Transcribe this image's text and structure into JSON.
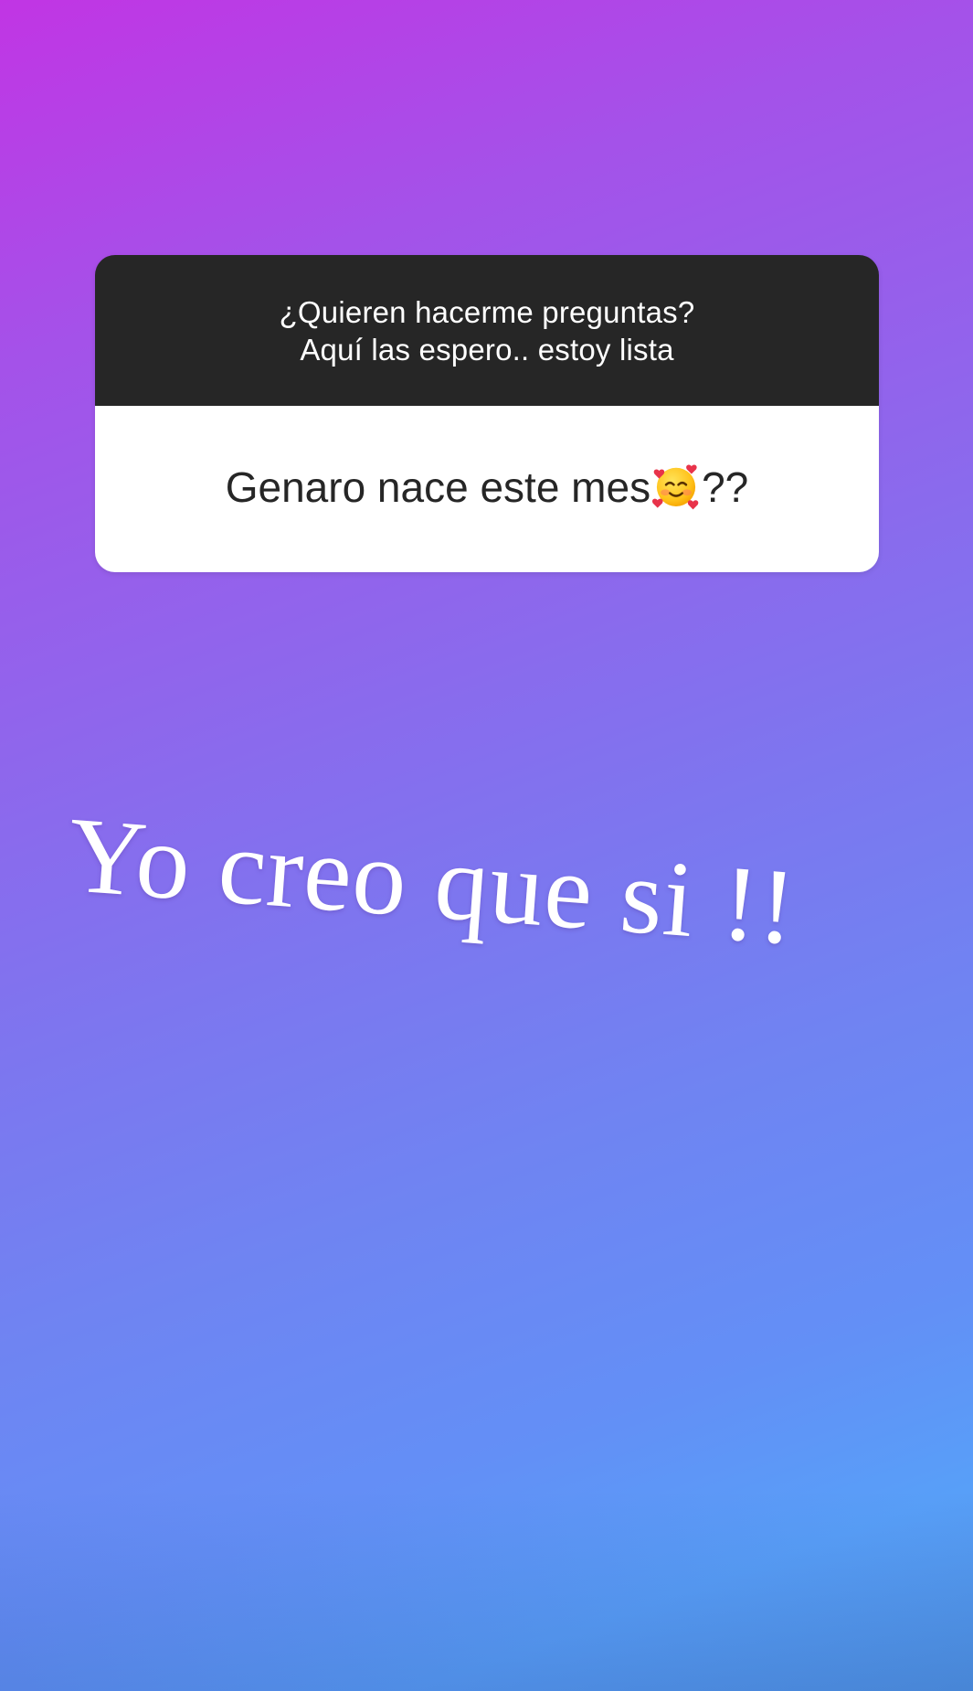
{
  "question_sticker": {
    "prompt_line_1": "¿Quieren hacerme preguntas?",
    "prompt_line_2": "Aquí las espero.. estoy lista",
    "answer_before_emoji": "Genaro nace este mes",
    "answer_emoji": "smiling-face-with-hearts-emoji",
    "answer_after_emoji": "??"
  },
  "overlay": {
    "reply_text": "Yo creo que si !!"
  },
  "colors": {
    "header_bg": "#262626",
    "answer_bg": "#ffffff",
    "gradient_top": "#c135e4",
    "gradient_bottom": "#589ff8"
  }
}
